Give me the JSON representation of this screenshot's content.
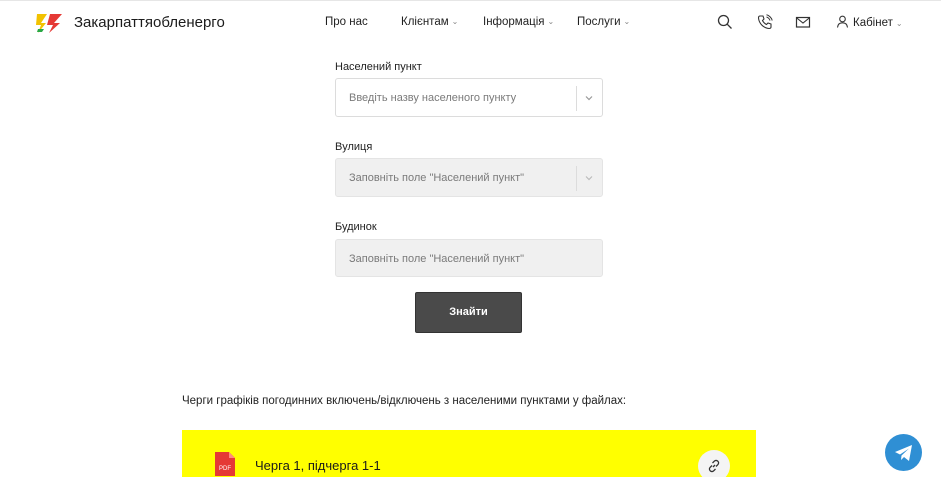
{
  "header": {
    "brand": "Закарпаттяобленерго",
    "nav": [
      {
        "label": "Про нас"
      },
      {
        "label": "Клієнтам"
      },
      {
        "label": "Інформація"
      },
      {
        "label": "Послуги"
      }
    ],
    "cabinet_label": "Кабінет",
    "icons": [
      "search-icon",
      "phone-icon",
      "mail-icon",
      "user-icon"
    ]
  },
  "form": {
    "settlement": {
      "label": "Населений пункт",
      "placeholder": "Введіть назву населеного пункту"
    },
    "street": {
      "label": "Вулиця",
      "placeholder": "Заповніть поле \"Населений пункт\""
    },
    "house": {
      "label": "Будинок",
      "placeholder": "Заповніть поле \"Населений пункт\""
    },
    "submit_label": "Знайти"
  },
  "files": {
    "description": "Черги графіків погодинних включень/відключень з населеними пунктами у файлах:",
    "items": [
      {
        "title": "Черга 1, підчерга 1-1",
        "icon": "pdf-icon"
      }
    ]
  },
  "colors": {
    "accent_yellow": "#ffff00",
    "button_dark": "#4a4a4a",
    "telegram_blue": "#2f8fd4"
  }
}
